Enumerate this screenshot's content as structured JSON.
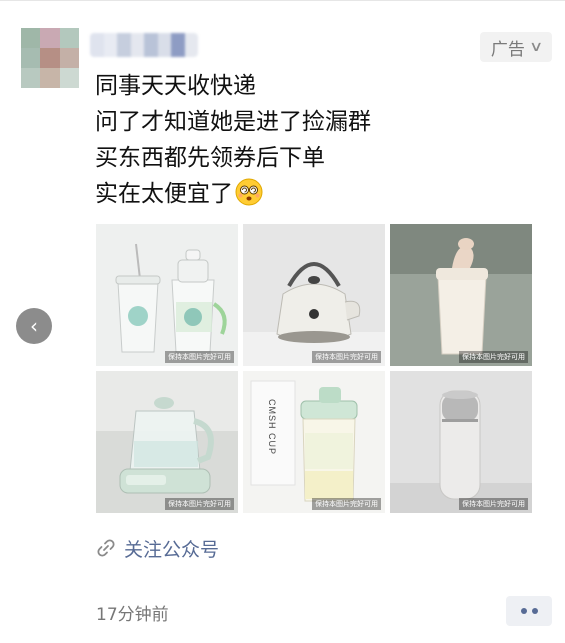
{
  "post": {
    "ad_label": "广告",
    "lines": [
      "同事天天收快递",
      "问了才知道她是进了捡漏群",
      "买东西都先领券后下单",
      "实在太便宜了"
    ],
    "emoji_icon": "dizzy-face-emoji",
    "images": [
      {
        "icon": "clear-tumblers-with-straws",
        "watermark": "保持本图片完好可用"
      },
      {
        "icon": "white-retro-kettle",
        "watermark": "保持本图片完好可用"
      },
      {
        "icon": "cream-insulated-cup",
        "watermark": "保持本图片完好可用"
      },
      {
        "icon": "glass-health-kettle",
        "watermark": "保持本图片完好可用"
      },
      {
        "icon": "cmsh-cup-bottle",
        "watermark": "保持本图片完好可用",
        "text": "CMSH CUP"
      },
      {
        "icon": "gray-thermos-bottle",
        "watermark": "保持本图片完好可用"
      }
    ],
    "follow_label": "关注公众号",
    "time": "17分钟前"
  },
  "colors": {
    "link": "#576b95",
    "badge_bg": "#f2f2f2"
  }
}
